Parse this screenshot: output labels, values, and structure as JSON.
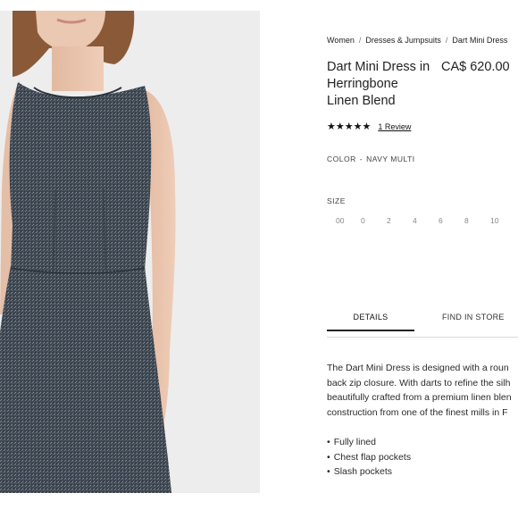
{
  "breadcrumb": {
    "items": [
      "Women",
      "Dresses & Jumpsuits",
      "Dart Mini Dress"
    ],
    "separator": "/"
  },
  "product": {
    "title": "Dart Mini Dress in Herringbone Linen Blend",
    "price": "CA$ 620.00",
    "rating_stars": 5,
    "review_link": "1 Review",
    "color_label": "COLOR",
    "color_value": "NAVY MULTI",
    "size_label": "SIZE",
    "sizes": [
      "00",
      "0",
      "2",
      "4",
      "6",
      "8",
      "10"
    ]
  },
  "tabs": [
    {
      "label": "DETAILS",
      "active": true
    },
    {
      "label": "FIND IN STORE",
      "active": false
    }
  ],
  "description": [
    "The Dart Mini Dress is designed with a roun",
    "back zip closure. With darts to refine the silh",
    "beautifully crafted from a premium linen blen",
    "construction from one of the finest mills in F"
  ],
  "features": [
    "Fully lined",
    "Chest flap pockets",
    "Slash pockets"
  ],
  "colors": {
    "photo_bg": "#ededed",
    "fabric": "#3d4650",
    "skin": "#e8c4ad",
    "hair": "#8a5a38"
  }
}
